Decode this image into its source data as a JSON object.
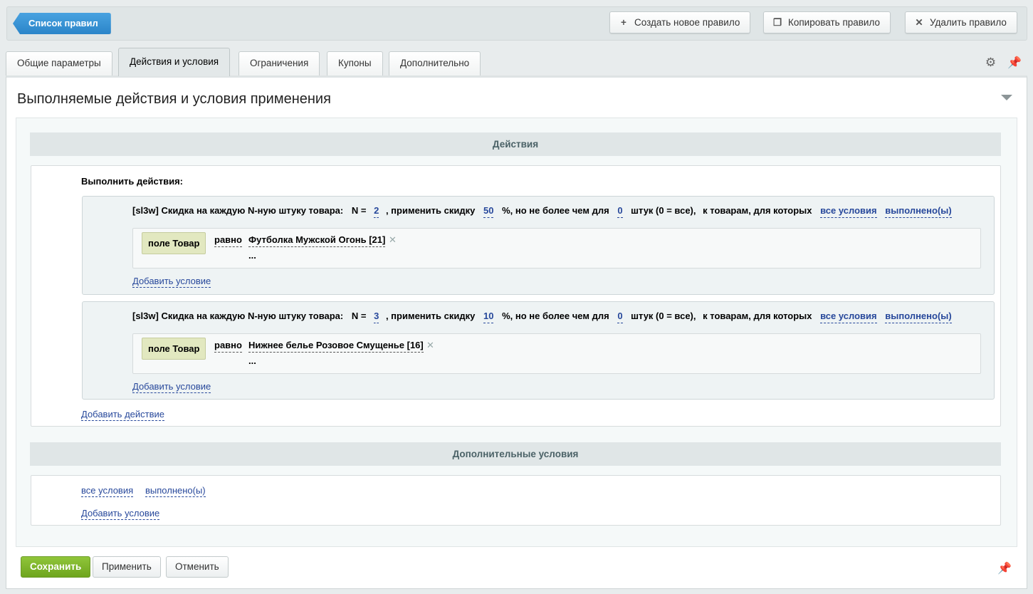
{
  "toolbar": {
    "back_label": "Список правил",
    "create_label": "Создать новое правило",
    "copy_label": "Копировать правило",
    "delete_label": "Удалить правило"
  },
  "tabs": [
    {
      "label": "Общие параметры"
    },
    {
      "label": "Действия и условия"
    },
    {
      "label": "Ограничения"
    },
    {
      "label": "Купоны"
    },
    {
      "label": "Дополнительно"
    }
  ],
  "panel": {
    "title": "Выполняемые действия и условия применения"
  },
  "actions_section": {
    "header": "Действия",
    "perform_label": "Выполнить действия:",
    "add_action_label": "Добавить действие",
    "items": [
      {
        "prefix": "[sl3w] Скидка на каждую N-ную штуку товара:",
        "n_label": "N =",
        "n_value": "2",
        "discount_label": ", применить скидку",
        "discount_value": "50",
        "limit_label": "%, но не более чем для",
        "limit_value": "0",
        "pieces_label": "штук (0 = все),",
        "goods_label": "к товарам, для которых",
        "all_conditions": "все условия",
        "fulfilled": "выполнено(ы)",
        "condition": {
          "field": "поле Товар",
          "operator": "равно",
          "value": "Футболка Мужской Огонь [21]",
          "more": "..."
        },
        "add_condition_label": "Добавить условие"
      },
      {
        "prefix": "[sl3w] Скидка на каждую N-ную штуку товара:",
        "n_label": "N =",
        "n_value": "3",
        "discount_label": ", применить скидку",
        "discount_value": "10",
        "limit_label": "%, но не более чем для",
        "limit_value": "0",
        "pieces_label": "штук (0 = все),",
        "goods_label": "к товарам, для которых",
        "all_conditions": "все условия",
        "fulfilled": "выполнено(ы)",
        "condition": {
          "field": "поле Товар",
          "operator": "равно",
          "value": "Нижнее белье Розовое Смущенье [16]",
          "more": "..."
        },
        "add_condition_label": "Добавить условие"
      }
    ]
  },
  "extra_section": {
    "header": "Дополнительные условия",
    "all_conditions": "все условия",
    "fulfilled": "выполнено(ы)",
    "add_condition_label": "Добавить условие"
  },
  "footer": {
    "save_label": "Сохранить",
    "apply_label": "Применить",
    "cancel_label": "Отменить"
  },
  "icons": {
    "create": "plus-icon",
    "copy": "copy-icon",
    "delete": "close-icon",
    "settings": "gear-icon",
    "pin": "pin-icon",
    "collapse": "chevron-down-icon",
    "remove": "remove-icon"
  },
  "colors": {
    "accent_blue": "#2a85c9",
    "save_green": "#7ab02a",
    "link": "#27489b",
    "field_chip": "#e2e8c0"
  }
}
